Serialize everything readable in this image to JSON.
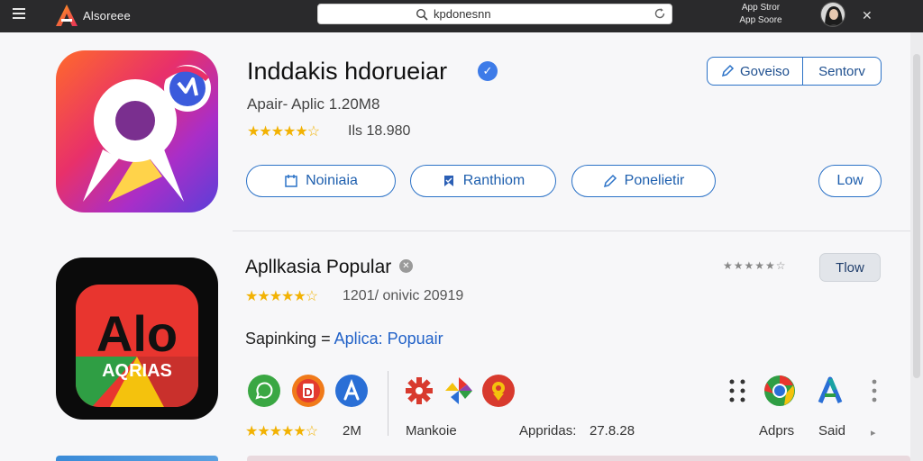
{
  "topbar": {
    "brand": "Alsoreee",
    "search_query": "kpdonesnn",
    "store_line1": "App Stror",
    "store_line2": "App Soore"
  },
  "featured": {
    "title": "Inddakis hdorueiar",
    "subtitle": "Apair- Aplic 1.20M8",
    "rating_text": "Ils 18.980",
    "stars": 4.5,
    "actions": [
      {
        "label": "Noiniaia",
        "icon": "calendar-icon"
      },
      {
        "label": "Ranthiom",
        "icon": "bookmark-icon"
      },
      {
        "label": "Ponelietir",
        "icon": "edit-icon"
      }
    ],
    "low_label": "Low",
    "top_buttons": [
      {
        "label": "Goveiso",
        "icon": "edit-icon"
      },
      {
        "label": "Sentorv"
      }
    ]
  },
  "popular": {
    "title": "Apllkasia Popular",
    "rating_text": "1201/ onivic 20919",
    "stars": 4.5,
    "breadcrumb_prefix": "Sapinking",
    "breadcrumb_sep": " = ",
    "breadcrumb_link": "Aplica: Popuair",
    "button_label": "Tlow",
    "icon_text": "Alo",
    "icon_subtext": "AQRIAS",
    "mini_stars": 4.5,
    "row_stars_text": "2M",
    "labels": {
      "mankole": "Mankoie",
      "appridas": "Appridas:",
      "appridas_value": "27.8.28",
      "adprs": "Adprs",
      "said": "Said"
    }
  },
  "colors": {
    "accent": "#2b72c7",
    "star": "#f2b203",
    "topbar": "#2a2a2c"
  }
}
